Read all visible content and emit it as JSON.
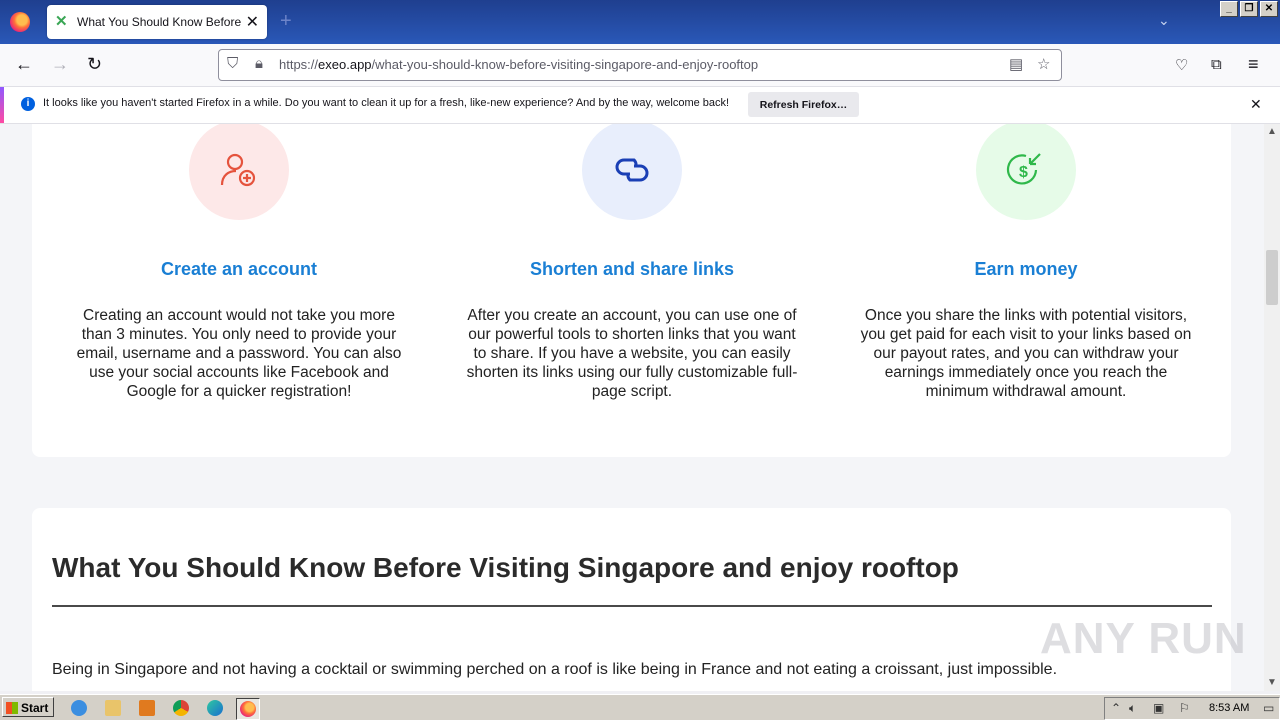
{
  "browser": {
    "tab_title": "What You Should Know Before Visiting Singapore and enjoy rooftop",
    "url_prefix": "https://",
    "url_host": "exeo.app",
    "url_path": "/what-you-should-know-before-visiting-singapore-and-enjoy-rooftop",
    "notification_text": "It looks like you haven't started Firefox in a while. Do you want to clean it up for a fresh, like-new experience? And by the way, welcome back!",
    "notification_button": "Refresh Firefox…"
  },
  "features": [
    {
      "title": "Create an account",
      "description": "Creating an account would not take you more than 3 minutes. You only need to provide your email, username and a password. You can also use your social accounts like Facebook and Google for a quicker registration!",
      "icon": "add-user-icon",
      "circle_color": "#fde8e8",
      "icon_color": "#e5533d"
    },
    {
      "title": "Shorten and share links",
      "description": "After you create an account, you can use one of our powerful tools to shorten links that you want to share. If you have a website, you can easily shorten its links using our fully customizable full-page script.",
      "icon": "link-icon",
      "circle_color": "#e8eefc",
      "icon_color": "#1a3fb5"
    },
    {
      "title": "Earn money",
      "description": "Once you share the links with potential visitors, you get paid for each visit to your links based on our payout rates, and you can withdraw your earnings immediately once you reach the minimum withdrawal amount.",
      "icon": "dollar-in-icon",
      "circle_color": "#e6fbe8",
      "icon_color": "#2fb84a"
    }
  ],
  "article": {
    "title": "What You Should Know Before Visiting Singapore and enjoy rooftop",
    "first_paragraph": "Being in Singapore and not having a cocktail or swimming perched on a roof is like being in France and not eating a croissant, just impossible."
  },
  "watermark": "ANY RUN",
  "taskbar": {
    "start_label": "Start",
    "clock": "8:53 AM"
  },
  "colors": {
    "accent": "#1a7fd4",
    "titlebar": "#2a58b8"
  }
}
